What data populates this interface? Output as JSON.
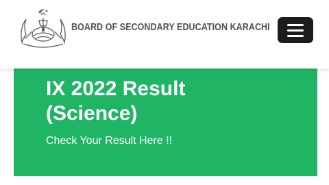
{
  "header": {
    "org_name": "BOARD OF SECONDARY EDUCATION KARACHI",
    "logo_icon": "bsek-emblem-icon",
    "menu_icon": "hamburger-menu-icon"
  },
  "hero": {
    "title_line1": "IX 2022 Result",
    "title_line2": "(Science)",
    "link_text": "Check Your Result Here !!"
  },
  "colors": {
    "hero_bg": "#1fb565",
    "menu_button_bg": "#1c1c1c",
    "brand_text": "#505050"
  }
}
